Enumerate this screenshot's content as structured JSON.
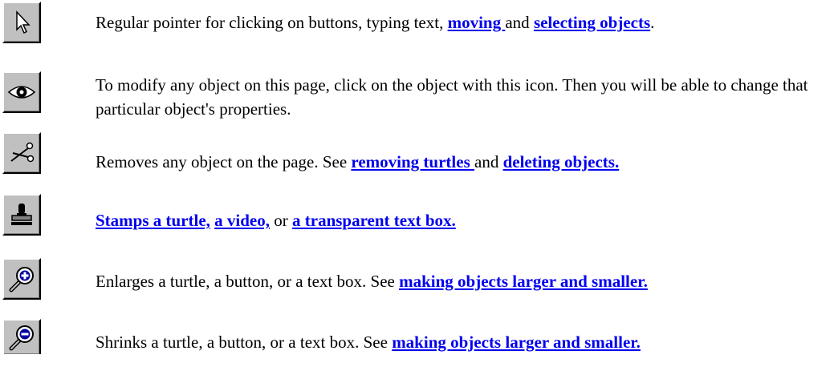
{
  "tools": [
    {
      "icon": "arrow-pointer-icon",
      "parts": [
        {
          "text": "Regular pointer for clicking on buttons, typing text, "
        },
        {
          "text": "moving ",
          "link": true
        },
        {
          "text": "  and "
        },
        {
          "text": "selecting objects",
          "link": true
        },
        {
          "text": "."
        }
      ]
    },
    {
      "icon": "eye-icon",
      "parts": [
        {
          "text": "To modify any object on this page, click on the object with this icon. Then you will be able to change that particular object's properties."
        }
      ]
    },
    {
      "icon": "scissors-icon",
      "parts": [
        {
          "text": "Removes any object on the page. See "
        },
        {
          "text": "removing turtles ",
          "link": true
        },
        {
          "text": " and "
        },
        {
          "text": "deleting objects.",
          "link": true
        }
      ]
    },
    {
      "icon": "stamp-icon",
      "parts": [
        {
          "text": "Stamps a turtle,",
          "link": true
        },
        {
          "text": "  "
        },
        {
          "text": "a video,",
          "link": true
        },
        {
          "text": " or "
        },
        {
          "text": "a transparent text box.",
          "link": true
        }
      ]
    },
    {
      "icon": "magnifier-plus-icon",
      "parts": [
        {
          "text": "Enlarges a turtle, a button, or a text box. See "
        },
        {
          "text": "making objects larger and smaller.",
          "link": true
        }
      ]
    },
    {
      "icon": "magnifier-minus-icon",
      "parts": [
        {
          "text": "Shrinks a turtle, a button, or a text box. See "
        },
        {
          "text": "making objects larger and smaller.",
          "link": true
        }
      ]
    }
  ],
  "colors": {
    "link": "#0000ee",
    "button_face": "#c0c0c0",
    "button_shadow": "#808080"
  }
}
